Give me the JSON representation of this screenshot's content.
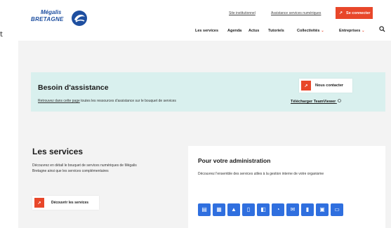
{
  "stray_char": "t",
  "header": {
    "logo": {
      "line1": "Mégalis",
      "line2": "BRETAGNE"
    },
    "util_links": [
      "Site institutionnel",
      "Assistance services numériques"
    ],
    "connect_label": "Se connecter",
    "nav": [
      {
        "label": "Les services",
        "has_chevron": false
      },
      {
        "label": "Agenda",
        "has_chevron": false
      },
      {
        "label": "Actus",
        "has_chevron": false
      },
      {
        "label": "Tutoriels",
        "has_chevron": false
      },
      {
        "label": "Collectivités",
        "has_chevron": true
      },
      {
        "label": "Entreprises",
        "has_chevron": true
      }
    ],
    "search_icon": "search-icon"
  },
  "assistance": {
    "title": "Besoin d'assistance",
    "text_link": "Retrouvez dans cette page",
    "text_rest": " toutes les ressources d'assistance sur le bouquet de services",
    "contact_label": "Nous contacter",
    "teamviewer_label": "Télécharger TeamViewer"
  },
  "services": {
    "title": "Les services",
    "text": "Découvrez en détail le bouquet de services numériques de Mégalis Bretagne ainsi que les services complémentaires",
    "button_label": "Découvrir les services"
  },
  "admin": {
    "title": "Pour votre administration",
    "text": "Découvrez l'ensemble des services utiles à la gestion interne de votre organisme",
    "tiles": [
      "document-icon",
      "table-icon",
      "landscape-icon",
      "file-icon",
      "chart-icon",
      "clock-icon",
      "mail-icon",
      "phone-icon",
      "building-icon",
      "archive-icon"
    ]
  },
  "colors": {
    "accent": "#e8472a",
    "brand": "#1e4fa0",
    "tile": "#2f6fdf",
    "assist_bg": "#d9f0ee"
  }
}
